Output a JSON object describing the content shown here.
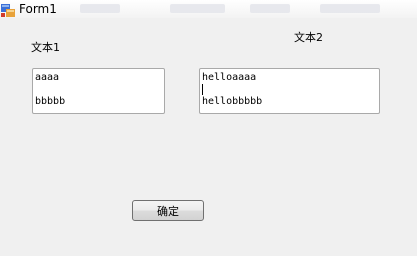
{
  "window": {
    "title": "Form1"
  },
  "labels": {
    "label1": "文本1",
    "label2": "文本2"
  },
  "textbox1": {
    "lines": [
      "aaaa",
      "",
      "bbbbb"
    ]
  },
  "textbox2": {
    "lines": [
      "helloaaaa",
      "",
      "hellobbbbb"
    ]
  },
  "button": {
    "label": "确定"
  },
  "colors": {
    "background": "#f0f0f0",
    "textbox_border": "#a9a9a9"
  }
}
